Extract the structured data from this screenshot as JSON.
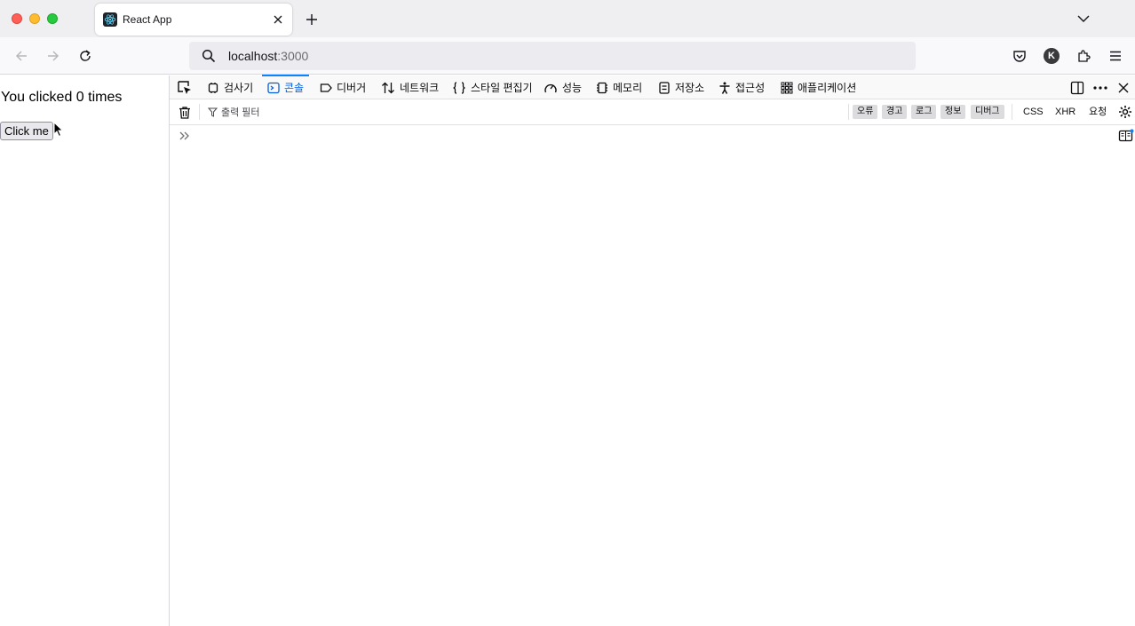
{
  "browser": {
    "tab": {
      "title": "React App",
      "favicon": "react-logo-icon"
    },
    "url": {
      "host": "localhost",
      "port": ":3000"
    },
    "profile_initial": "K"
  },
  "page": {
    "counter_text": "You clicked 0 times",
    "button_label": "Click me"
  },
  "devtools": {
    "tabs": [
      {
        "label": "검사기",
        "icon": "inspector-icon"
      },
      {
        "label": "콘솔",
        "icon": "console-icon",
        "active": true
      },
      {
        "label": "디버거",
        "icon": "debugger-icon"
      },
      {
        "label": "네트워크",
        "icon": "network-icon"
      },
      {
        "label": "스타일 편집기",
        "icon": "style-editor-icon"
      },
      {
        "label": "성능",
        "icon": "performance-icon"
      },
      {
        "label": "메모리",
        "icon": "memory-icon"
      },
      {
        "label": "저장소",
        "icon": "storage-icon"
      },
      {
        "label": "접근성",
        "icon": "accessibility-icon"
      },
      {
        "label": "애플리케이션",
        "icon": "application-icon"
      }
    ],
    "console": {
      "filter_placeholder": "출력 필터",
      "levels": [
        "오류",
        "경고",
        "로그",
        "정보",
        "디버그"
      ],
      "extra_filters": [
        "CSS",
        "XHR",
        "요청"
      ]
    }
  },
  "colors": {
    "accent": "#0a84ff",
    "active_tab_text": "#0060df"
  }
}
